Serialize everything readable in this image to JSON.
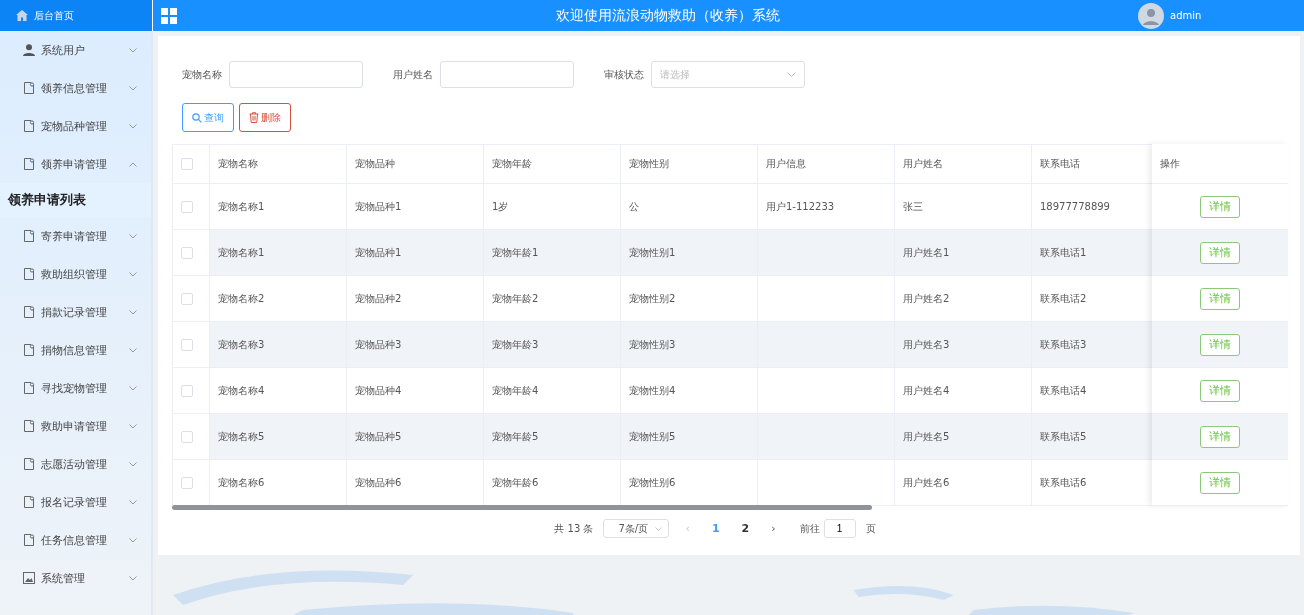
{
  "sidebar": {
    "home": "后台首页",
    "items": [
      {
        "label": "系统用户",
        "kind": "person",
        "expanded": false
      },
      {
        "label": "领养信息管理",
        "kind": "doc",
        "expanded": false
      },
      {
        "label": "宠物品种管理",
        "kind": "doc",
        "expanded": false
      },
      {
        "label": "领养申请管理",
        "kind": "doc",
        "expanded": true,
        "children": [
          {
            "label": "领养申请列表",
            "selected": true
          }
        ]
      },
      {
        "label": "寄养申请管理",
        "kind": "doc",
        "expanded": false
      },
      {
        "label": "救助组织管理",
        "kind": "doc",
        "expanded": false
      },
      {
        "label": "捐款记录管理",
        "kind": "doc",
        "expanded": false
      },
      {
        "label": "捐物信息管理",
        "kind": "doc",
        "expanded": false
      },
      {
        "label": "寻找宠物管理",
        "kind": "doc",
        "expanded": false
      },
      {
        "label": "救助申请管理",
        "kind": "doc",
        "expanded": false
      },
      {
        "label": "志愿活动管理",
        "kind": "doc",
        "expanded": false
      },
      {
        "label": "报名记录管理",
        "kind": "doc",
        "expanded": false
      },
      {
        "label": "任务信息管理",
        "kind": "doc",
        "expanded": false
      },
      {
        "label": "系统管理",
        "kind": "image",
        "expanded": false
      }
    ]
  },
  "header": {
    "title": "欢迎使用流浪动物救助（收养）系统",
    "user": "admin"
  },
  "search": {
    "fields": [
      {
        "label": "宠物名称",
        "kind": "input"
      },
      {
        "label": "用户姓名",
        "kind": "input"
      },
      {
        "label": "审核状态",
        "kind": "select",
        "placeholder": "请选择"
      }
    ],
    "buttons": [
      {
        "label": "查询",
        "kind": "search"
      },
      {
        "label": "删除",
        "kind": "delete"
      }
    ]
  },
  "table": {
    "columns": [
      "宠物名称",
      "宠物品种",
      "宠物年龄",
      "宠物性别",
      "用户信息",
      "用户姓名",
      "联系电话"
    ],
    "action_column": "操作",
    "all_checked": false,
    "rows": [
      {
        "cells": [
          "宠物名称1",
          "宠物品种1",
          "1岁",
          "公",
          "用户1-112233",
          "张三",
          "18977778899"
        ],
        "checked": false,
        "action": "详情"
      },
      {
        "cells": [
          "宠物名称1",
          "宠物品种1",
          "宠物年龄1",
          "宠物性别1",
          "",
          "用户姓名1",
          "联系电话1"
        ],
        "checked": false,
        "action": "详情"
      },
      {
        "cells": [
          "宠物名称2",
          "宠物品种2",
          "宠物年龄2",
          "宠物性别2",
          "",
          "用户姓名2",
          "联系电话2"
        ],
        "checked": false,
        "action": "详情"
      },
      {
        "cells": [
          "宠物名称3",
          "宠物品种3",
          "宠物年龄3",
          "宠物性别3",
          "",
          "用户姓名3",
          "联系电话3"
        ],
        "checked": false,
        "action": "详情"
      },
      {
        "cells": [
          "宠物名称4",
          "宠物品种4",
          "宠物年龄4",
          "宠物性别4",
          "",
          "用户姓名4",
          "联系电话4"
        ],
        "checked": false,
        "action": "详情"
      },
      {
        "cells": [
          "宠物名称5",
          "宠物品种5",
          "宠物年龄5",
          "宠物性别5",
          "",
          "用户姓名5",
          "联系电话5"
        ],
        "checked": false,
        "action": "详情"
      },
      {
        "cells": [
          "宠物名称6",
          "宠物品种6",
          "宠物年龄6",
          "宠物性别6",
          "",
          "用户姓名6",
          "联系电话6"
        ],
        "checked": false,
        "action": "详情"
      }
    ]
  },
  "pagination": {
    "total": "共 13 条",
    "page_size": "7条/页",
    "prev": "‹",
    "next": "›",
    "pages": [
      {
        "label": "1",
        "selected": true
      },
      {
        "label": "2",
        "selected": false
      }
    ],
    "goto_label": "前往",
    "goto_value": "1",
    "goto_suffix": "页"
  }
}
